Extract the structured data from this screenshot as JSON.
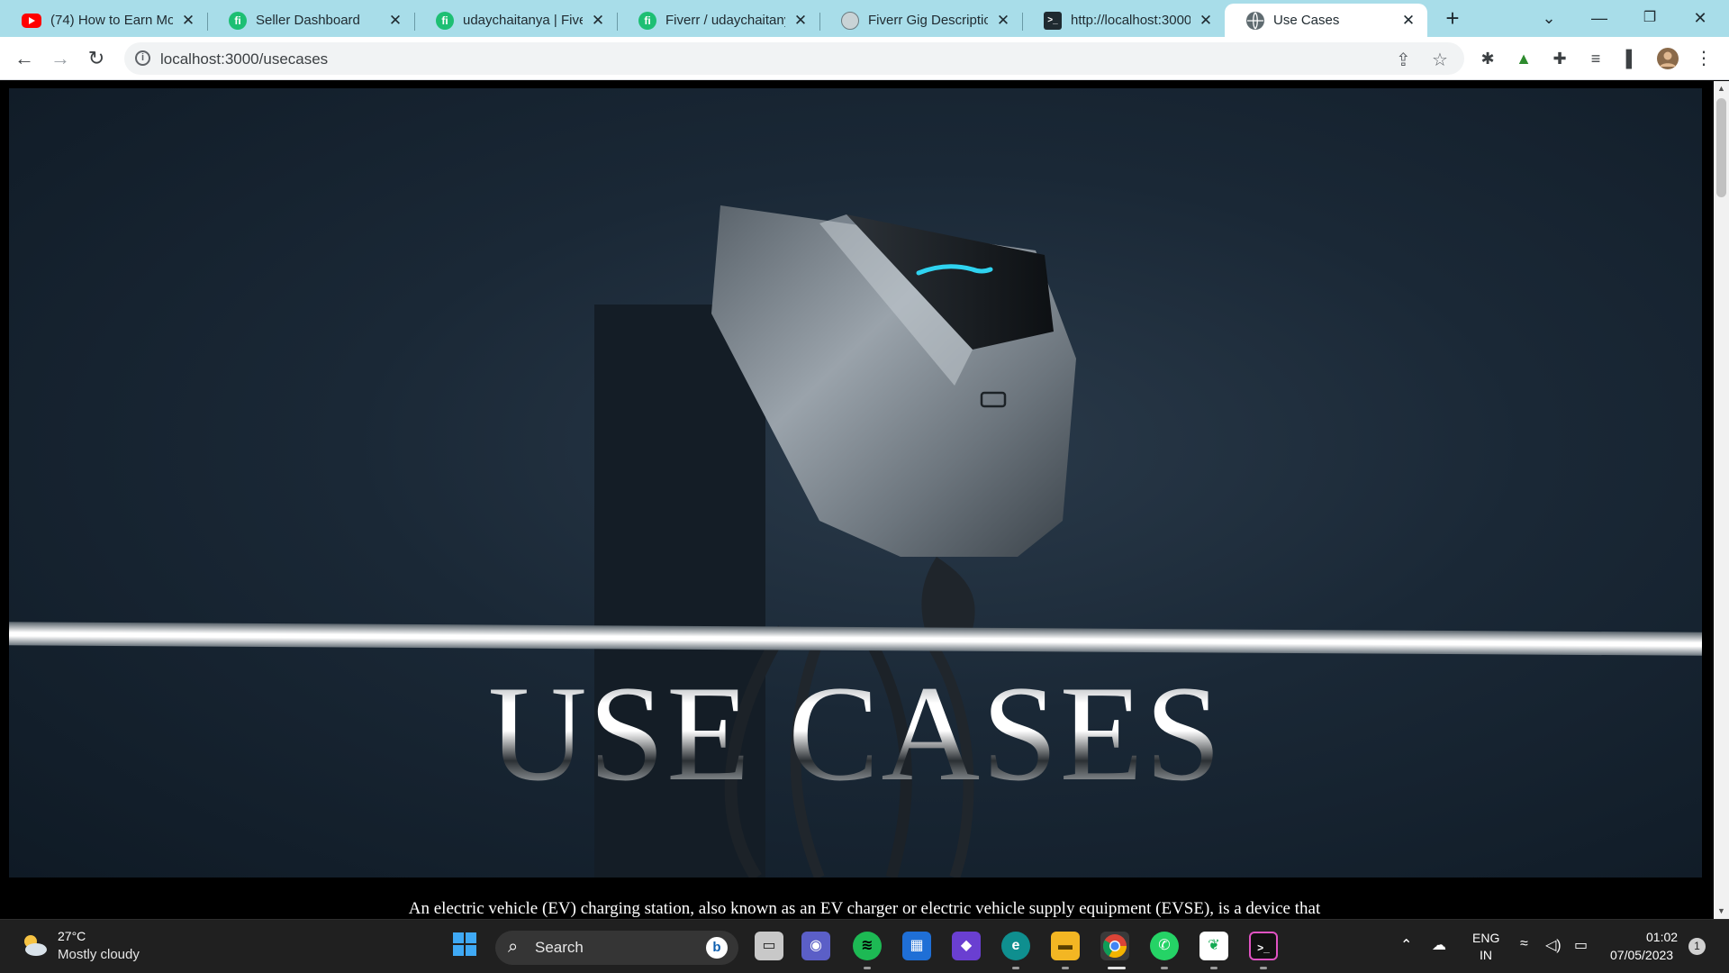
{
  "browser": {
    "tabs": [
      {
        "label": "(74) How to Earn Mon",
        "favicon": "youtube-icon"
      },
      {
        "label": "Seller Dashboard",
        "favicon": "fiverr-icon"
      },
      {
        "label": "udaychaitanya | Fiverr",
        "favicon": "fiverr-icon"
      },
      {
        "label": "Fiverr / udaychaitanya",
        "favicon": "fiverr-icon"
      },
      {
        "label": "Fiverr Gig Description",
        "favicon": "chatgpt-icon"
      },
      {
        "label": "http://localhost:3000",
        "favicon": "terminal-icon"
      },
      {
        "label": "Use Cases",
        "favicon": "globe-icon"
      }
    ],
    "active_tab": 6,
    "address": "localhost:3000/usecases"
  },
  "page": {
    "hero_title": "USE CASES",
    "intro_text": "An electric vehicle (EV) charging station, also known as an EV charger or electric vehicle supply equipment (EVSE), is a device that"
  },
  "taskbar": {
    "weather_temp": "27°C",
    "weather_desc": "Mostly cloudy",
    "search_label": "Search",
    "lang_line1": "ENG",
    "lang_line2": "IN",
    "time": "01:02",
    "date": "07/05/2023",
    "notification_count": "1"
  },
  "colors": {
    "tabstrip": "#a8dde9",
    "fiverr_green": "#1dbf73",
    "charger_glow": "#2fd3f0"
  }
}
